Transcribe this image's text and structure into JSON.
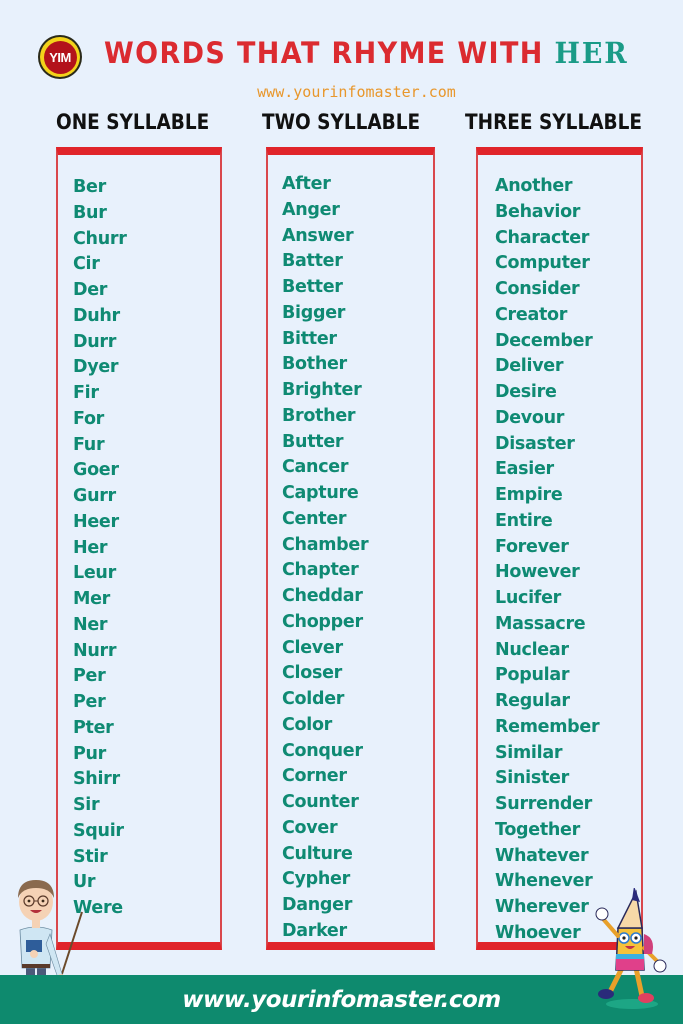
{
  "header": {
    "logo_text": "YIM",
    "title_main": "WORDS THAT RHYME WITH ",
    "title_accent": "HER",
    "subtitle": "www.yourinfomaster.com"
  },
  "colors": {
    "background": "#e8f1fc",
    "title_red": "#db2b30",
    "accent_teal": "#1a9b87",
    "word_green": "#0f8a73",
    "box_border_red": "#e0242a",
    "subtitle_orange": "#e8972c",
    "footer_green": "#0e8a6e"
  },
  "columns": [
    {
      "header": "ONE SYLLABLE",
      "words": [
        "Ber",
        "Bur",
        "Churr",
        "Cir",
        "Der",
        "Duhr",
        "Durr",
        "Dyer",
        "Fir",
        "For",
        "Fur",
        "Goer",
        "Gurr",
        "Heer",
        "Her",
        "Leur",
        "Mer",
        "Ner",
        "Nurr",
        "Per",
        "Per",
        "Pter",
        "Pur",
        "Shirr",
        "Sir",
        "Squir",
        "Stir",
        "Ur",
        "Were"
      ]
    },
    {
      "header": "TWO SYLLABLE",
      "words": [
        "After",
        "Anger",
        "Answer",
        "Batter",
        "Better",
        "Bigger",
        "Bitter",
        "Bother",
        "Brighter",
        "Brother",
        "Butter",
        "Cancer",
        "Capture",
        "Center",
        "Chamber",
        "Chapter",
        "Cheddar",
        "Chopper",
        "Clever",
        "Closer",
        "Colder",
        "Color",
        "Conquer",
        "Corner",
        "Counter",
        "Cover",
        "Culture",
        "Cypher",
        "Danger",
        "Darker"
      ]
    },
    {
      "header": "THREE SYLLABLE",
      "words": [
        "Another",
        "Behavior",
        "Character",
        "Computer",
        "Consider",
        "Creator",
        "December",
        "Deliver",
        "Desire",
        "Devour",
        "Disaster",
        "Easier",
        "Empire",
        "Entire",
        "Forever",
        "However",
        "Lucifer",
        "Massacre",
        "Nuclear",
        "Popular",
        "Regular",
        "Remember",
        "Similar",
        "Sinister",
        "Surrender",
        "Together",
        "Whatever",
        "Whenever",
        "Wherever",
        "Whoever"
      ]
    }
  ],
  "footer": {
    "url": "www.yourinfomaster.com"
  },
  "illustrations": {
    "left": "teacher-with-pointer-icon",
    "right": "pencil-mascot-icon"
  }
}
